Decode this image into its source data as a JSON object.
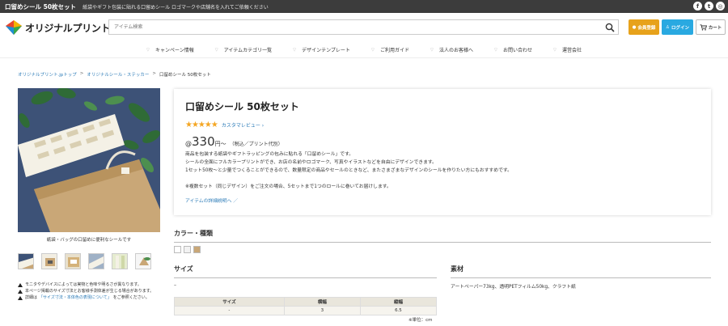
{
  "topbar": {
    "title": "口留めシール 50枚セット",
    "tagline": "紙袋やギフト包装に貼れる口留めシール ロゴマークや店舗名を入れてご依頼ください",
    "social": [
      "facebook-icon",
      "twitter-icon",
      "instagram-icon"
    ]
  },
  "header": {
    "logo_text": "オリジナルプリント.jp",
    "search_placeholder": "アイテム検索",
    "register_label": "会員登録",
    "login_label": "ログイン",
    "cart_label": "カート"
  },
  "nav": {
    "items": [
      "キャンペーン情報",
      "アイテムカテゴリ一覧",
      "デザインテンプレート",
      "ご利用ガイド",
      "法人のお客様へ",
      "お問い合わせ",
      "運営会社"
    ]
  },
  "breadcrumb": {
    "items": [
      "オリジナルプリント.jpトップ",
      "オリジナルシール・ステッカー",
      "口留めシール 50枚セット"
    ],
    "separator": ">"
  },
  "gallery": {
    "caption": "紙袋・バッグの口留めに便利なシールです",
    "thumb_count": 6
  },
  "notes": {
    "n1": "モニタやデバイスによっては実物と色味や明るさが異なります。",
    "n2": "本ページ掲載のサイズ寸法とお客様手測体差が生じる場合があります。",
    "n3_prefix": "詳細は",
    "n3_link": "「サイズ寸法・本体色の表現について」",
    "n3_suffix": "をご参照ください。"
  },
  "product": {
    "title": "口留めシール 50枚セット",
    "stars": "★★★★★",
    "review_link": "カスタマレビュー",
    "price_at": "@",
    "price_value": "330",
    "price_unit": "円〜",
    "price_note": "（税込／プリント代別）",
    "desc_lines": [
      "商品を包装する紙袋やギフトラッピングの包みに貼れる「口留めシール」です。",
      "シールの全面にフルカラープリントができ、お店の名前やロゴマーク、写真やイラストなどを自由にデザインできます。",
      "1セット50枚〜と少量でつくることができるので、数量限定の商品やセールのときなど、またさまざまなデザインのシールを作りたい方にもおすすめです。",
      "",
      "※複数セット（同じデザイン）をご注文の場合、5セットまで1つのロールに巻いてお届けします。"
    ],
    "detail_link": "アイテムの詳細説明へ"
  },
  "color_section": {
    "heading": "カラー・種類",
    "swatches": [
      "#ffffff",
      "#f2f2f2",
      "#c9a777"
    ]
  },
  "size_section": {
    "heading": "サイズ",
    "dash": "–",
    "columns": [
      "サイズ",
      "横幅",
      "縦幅"
    ],
    "rows": [
      [
        "-",
        "3",
        "6.5"
      ]
    ],
    "unit_note": "※単位：cm"
  },
  "material_section": {
    "heading": "素材",
    "text": "アートペーパー73kg、透明PETフィルム50kg、クラフト紙"
  },
  "colors": {
    "accent_blue": "#29a9e1",
    "accent_orange": "#e7a21b",
    "link": "#2a7ab7",
    "star": "#f4a623",
    "topbar": "#3c3c3c"
  }
}
